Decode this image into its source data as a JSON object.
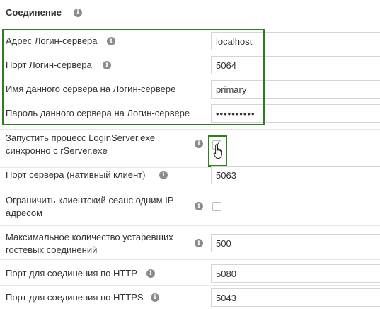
{
  "section": {
    "title": "Соединение"
  },
  "fields": {
    "login_server_address": {
      "label": "Адрес Логин-сервера",
      "value": "localhost"
    },
    "login_server_port": {
      "label": "Порт Логин-сервера",
      "value": "5064"
    },
    "server_name_on_login": {
      "label": "Имя данного сервера на Логин-сервере",
      "value": "primary"
    },
    "server_password_on_login": {
      "label": "Пароль данного сервера на Логин-сервере",
      "value": "••••••••••"
    },
    "sync_loginserver": {
      "label_line1": "Запустить процесс LoginServer.exe",
      "label_line2": "синхронно с rServer.exe",
      "checked": true
    },
    "server_port_native": {
      "label": "Порт сервера (нативный клиент)",
      "value": "5063"
    },
    "limit_session_ip": {
      "label_line1": "Ограничить клиентский сеанс одним IP-",
      "label_line2": "адресом",
      "checked": false
    },
    "max_guest_connections": {
      "label_line1": "Максимальное количество устаревших",
      "label_line2": "гостевых соединений",
      "value": "500"
    },
    "http_port": {
      "label": "Порт для соединения по HTTP",
      "value": "5080"
    },
    "https_port": {
      "label": "Порт для соединения по HTTPS",
      "value": "5043"
    }
  },
  "colors": {
    "highlight": "#2e7d1e",
    "info_icon": "#8c8c8c",
    "border": "#d5d5d5"
  }
}
